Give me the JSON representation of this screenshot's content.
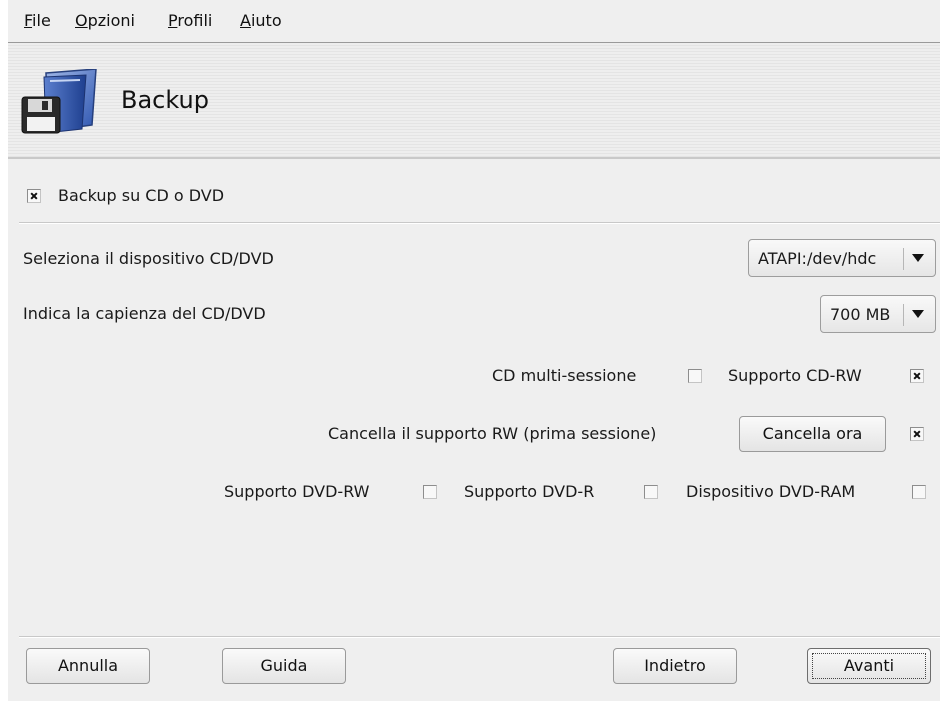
{
  "menu": {
    "file": {
      "accel": "F",
      "rest": "ile"
    },
    "options": {
      "accel": "O",
      "rest": "pzioni"
    },
    "profiles": {
      "accel": "P",
      "rest": "rofili"
    },
    "help": {
      "accel": "A",
      "rest": "iuto"
    }
  },
  "header": {
    "title": "Backup",
    "icon": "floppy-folder-icon"
  },
  "backup_cd": {
    "label": "Backup su CD o DVD",
    "checked": true
  },
  "device": {
    "label": "Seleziona il dispositivo CD/DVD",
    "selected": "ATAPI:/dev/hdc"
  },
  "capacity": {
    "label": "Indica la capienza del CD/DVD",
    "selected": "700 MB"
  },
  "multisession": {
    "label": "CD multi-sessione",
    "checked": false
  },
  "cdrw": {
    "label": "Supporto CD-RW",
    "checked": true
  },
  "erase": {
    "label": "Cancella il supporto RW (prima sessione)",
    "button": "Cancella ora",
    "checked": true
  },
  "dvdrw": {
    "label": "Supporto DVD-RW",
    "checked": false
  },
  "dvdr": {
    "label": "Supporto DVD-R",
    "checked": false
  },
  "dvdram": {
    "label": "Dispositivo DVD-RAM",
    "checked": false
  },
  "buttons": {
    "cancel": "Annulla",
    "help": "Guida",
    "back": "Indietro",
    "next": "Avanti"
  }
}
